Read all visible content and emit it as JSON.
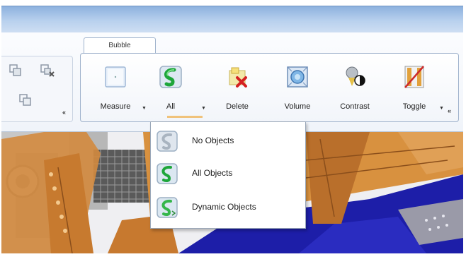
{
  "ribbon": {
    "tab_label": "Bubble",
    "buttons": [
      {
        "label": "Measure",
        "icon": "measure-icon",
        "has_dropdown": true
      },
      {
        "label": "All",
        "icon": "all-objects-icon",
        "has_dropdown": true
      },
      {
        "label": "Delete",
        "icon": "delete-icon",
        "has_dropdown": false
      },
      {
        "label": "Volume",
        "icon": "volume-icon",
        "has_dropdown": false
      },
      {
        "label": "Contrast",
        "icon": "contrast-icon",
        "has_dropdown": false
      },
      {
        "label": "Toggle",
        "icon": "toggle-icon",
        "has_dropdown": true
      }
    ],
    "launcher_glyph": "«"
  },
  "dropdown": {
    "items": [
      {
        "label": "No Objects",
        "icon": "no-objects-icon"
      },
      {
        "label": "All Objects",
        "icon": "all-objects-icon"
      },
      {
        "label": "Dynamic Objects",
        "icon": "dynamic-objects-icon"
      }
    ]
  },
  "colors": {
    "accent": "#f0c27b",
    "ribbon_border": "#9fb2cc",
    "titlebar": "#b9d1ee",
    "scene_orange": "#d3893e",
    "scene_blue": "#1d1ea8"
  }
}
